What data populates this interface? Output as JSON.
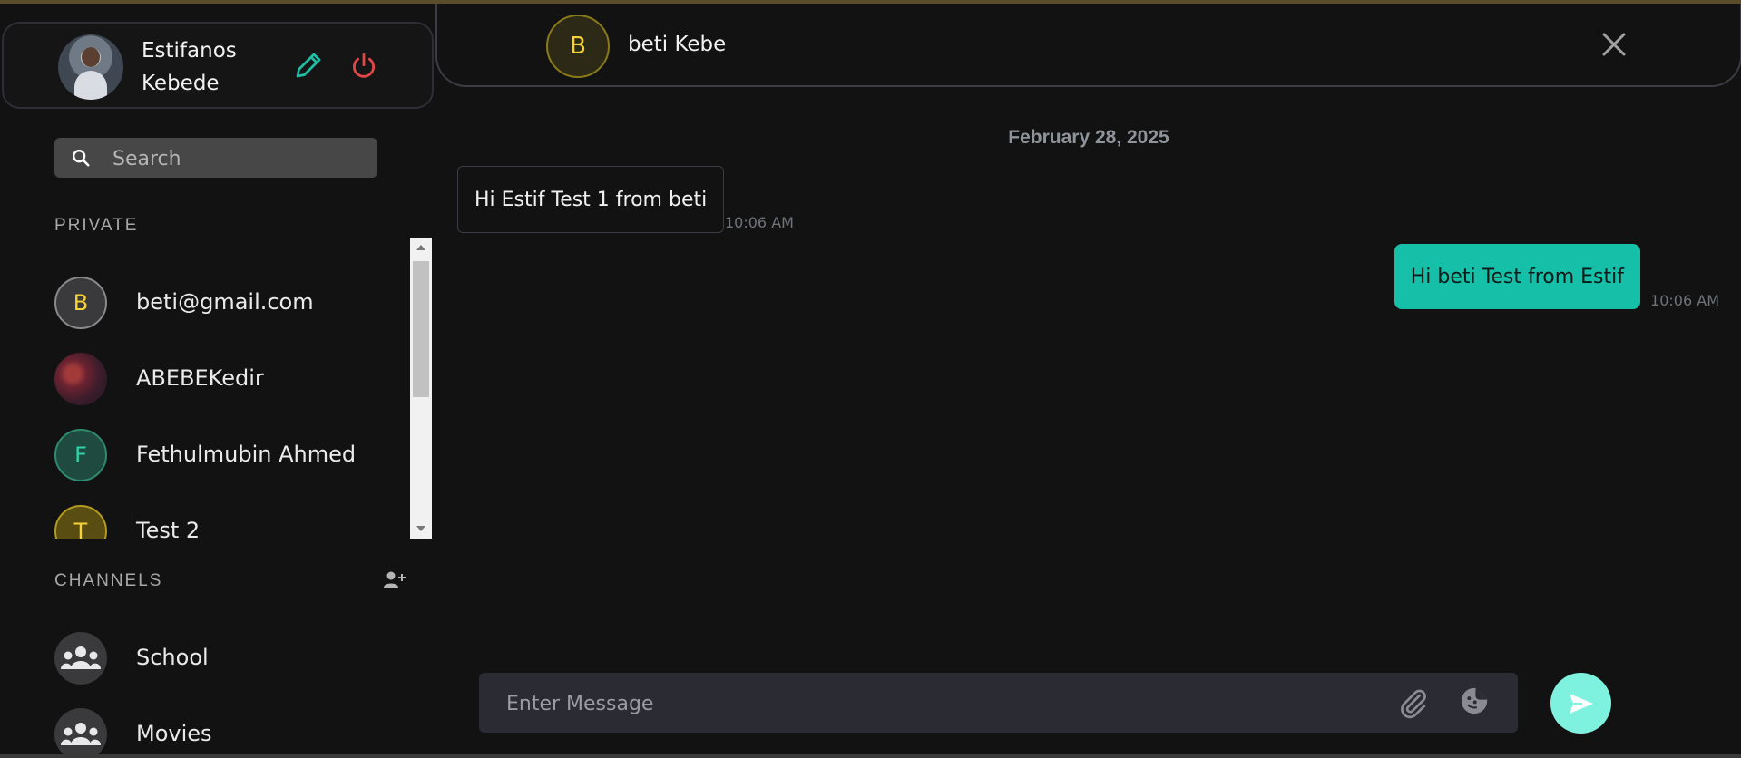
{
  "user": {
    "first_name": "Estifanos",
    "last_name": "Kebede",
    "edit_icon": "pencil-icon",
    "logout_icon": "power-icon",
    "colors": {
      "edit": "#1fbfa6",
      "logout": "#e04848"
    }
  },
  "search": {
    "placeholder": "Search",
    "value": "",
    "icon": "search-icon"
  },
  "private": {
    "title": "PRIVATE",
    "contacts": [
      {
        "initial": "B",
        "name": "beti@gmail.com"
      },
      {
        "initial": "",
        "name": "ABEBEKedir"
      },
      {
        "initial": "F",
        "name": "Fethulmubin Ahmed"
      },
      {
        "initial": "T",
        "name": "Test 2"
      }
    ]
  },
  "channels": {
    "title": "CHANNELS",
    "add_icon": "add-user-icon",
    "items": [
      {
        "name": "School",
        "icon": "group-icon"
      },
      {
        "name": "Movies",
        "icon": "group-icon"
      }
    ]
  },
  "chat": {
    "contact_initial": "B",
    "contact_name": "beti Kebe",
    "close_icon": "close-icon",
    "date": "February 28, 2025",
    "messages": [
      {
        "text": "Hi Estif Test 1 from beti",
        "time": "10:06 AM",
        "direction": "incoming"
      },
      {
        "text": "Hi beti Test from Estif",
        "time": "10:06 AM",
        "direction": "outgoing"
      }
    ],
    "composer": {
      "placeholder": "Enter Message",
      "value": "",
      "attach_icon": "paperclip-icon",
      "sticker_icon": "sticker-icon",
      "send_icon": "send-icon"
    },
    "colors": {
      "outgoing_bubble": "#16bfa8",
      "send_button": "#7ef2de"
    }
  }
}
